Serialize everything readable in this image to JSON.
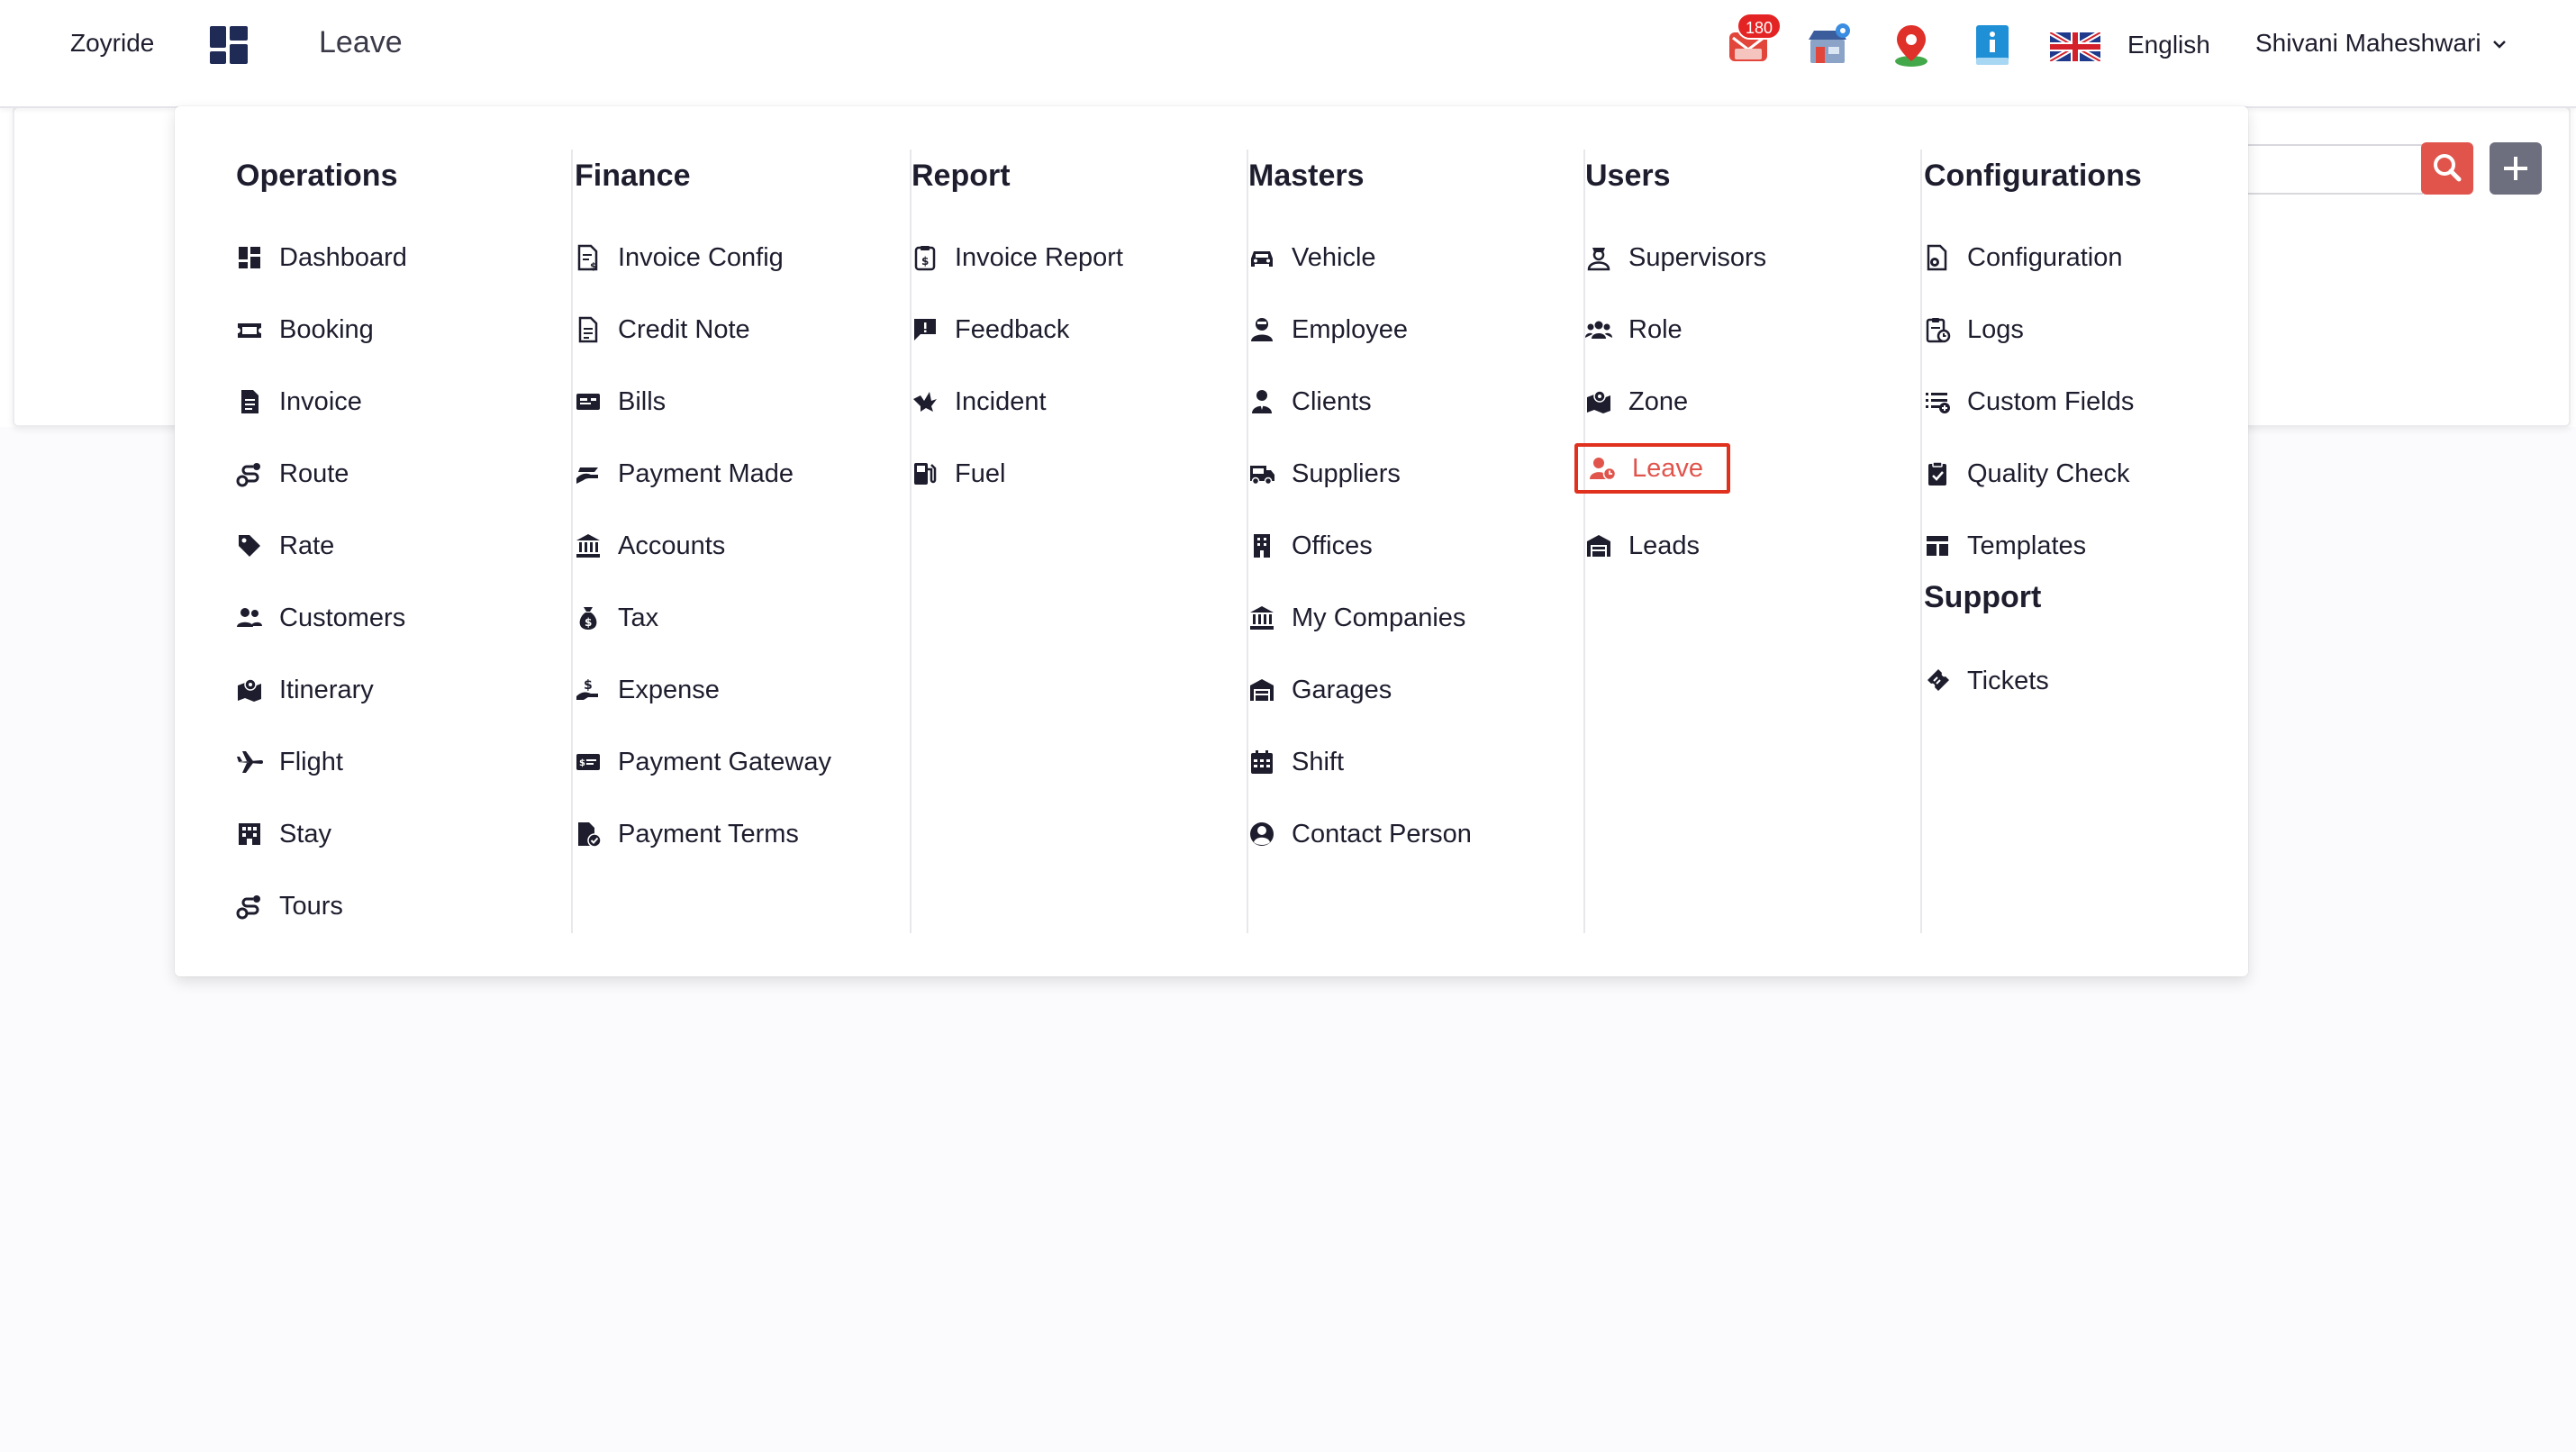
{
  "header": {
    "brand": "Zoyride",
    "page_title": "Leave",
    "notification_count": "180",
    "language": "English",
    "user_name": "Shivani Maheshwari"
  },
  "colors": {
    "accent_red": "#e0544c",
    "highlight_border": "#e0301e",
    "dark_icon": "#1d1d2e",
    "add_button": "#6d6f7e"
  },
  "menu": {
    "columns": [
      {
        "heading": "Operations",
        "items": [
          {
            "label": "Dashboard",
            "icon": "dashboard-icon"
          },
          {
            "label": "Booking",
            "icon": "ticket-icon"
          },
          {
            "label": "Invoice",
            "icon": "document-icon"
          },
          {
            "label": "Route",
            "icon": "route-icon"
          },
          {
            "label": "Rate",
            "icon": "tag-icon"
          },
          {
            "label": "Customers",
            "icon": "users-icon"
          },
          {
            "label": "Itinerary",
            "icon": "map-icon"
          },
          {
            "label": "Flight",
            "icon": "plane-icon"
          },
          {
            "label": "Stay",
            "icon": "hotel-icon"
          },
          {
            "label": "Tours",
            "icon": "route-icon"
          }
        ]
      },
      {
        "heading": "Finance",
        "items": [
          {
            "label": "Invoice Config",
            "icon": "invoice-config-icon"
          },
          {
            "label": "Credit Note",
            "icon": "note-icon"
          },
          {
            "label": "Bills",
            "icon": "bill-icon"
          },
          {
            "label": "Payment Made",
            "icon": "payment-hand-icon"
          },
          {
            "label": "Accounts",
            "icon": "bank-icon"
          },
          {
            "label": "Tax",
            "icon": "money-bag-icon"
          },
          {
            "label": "Expense",
            "icon": "expense-icon"
          },
          {
            "label": "Payment Gateway",
            "icon": "card-icon"
          },
          {
            "label": "Payment Terms",
            "icon": "file-check-icon"
          }
        ]
      },
      {
        "heading": "Report",
        "items": [
          {
            "label": "Invoice Report",
            "icon": "receipt-icon"
          },
          {
            "label": "Feedback",
            "icon": "feedback-icon"
          },
          {
            "label": "Incident",
            "icon": "incident-icon"
          },
          {
            "label": "Fuel",
            "icon": "fuel-icon"
          }
        ]
      },
      {
        "heading": "Masters",
        "items": [
          {
            "label": "Vehicle",
            "icon": "car-icon"
          },
          {
            "label": "Employee",
            "icon": "employee-icon"
          },
          {
            "label": "Clients",
            "icon": "client-icon"
          },
          {
            "label": "Suppliers",
            "icon": "van-icon"
          },
          {
            "label": "Offices",
            "icon": "building-icon"
          },
          {
            "label": "My Companies",
            "icon": "bank-icon"
          },
          {
            "label": "Garages",
            "icon": "garage-icon"
          },
          {
            "label": "Shift",
            "icon": "calendar-icon"
          },
          {
            "label": "Contact Person",
            "icon": "user-circle-icon"
          }
        ]
      },
      {
        "heading": "Users",
        "items": [
          {
            "label": "Supervisors",
            "icon": "supervisor-icon"
          },
          {
            "label": "Role",
            "icon": "users-group-icon"
          },
          {
            "label": "Zone",
            "icon": "map-icon"
          },
          {
            "label": "Leave",
            "icon": "user-clock-icon",
            "active": true
          },
          {
            "label": "Leads",
            "icon": "garage-icon"
          }
        ]
      },
      {
        "heading": "Configurations",
        "items": [
          {
            "label": "Configuration",
            "icon": "file-gear-icon"
          },
          {
            "label": "Logs",
            "icon": "log-icon"
          },
          {
            "label": "Custom Fields",
            "icon": "list-plus-icon"
          },
          {
            "label": "Quality Check",
            "icon": "clipboard-check-icon"
          },
          {
            "label": "Templates",
            "icon": "template-icon"
          }
        ],
        "sub_heading": "Support",
        "sub_items": [
          {
            "label": "Tickets",
            "icon": "ticket-diagonal-icon"
          }
        ]
      }
    ]
  }
}
